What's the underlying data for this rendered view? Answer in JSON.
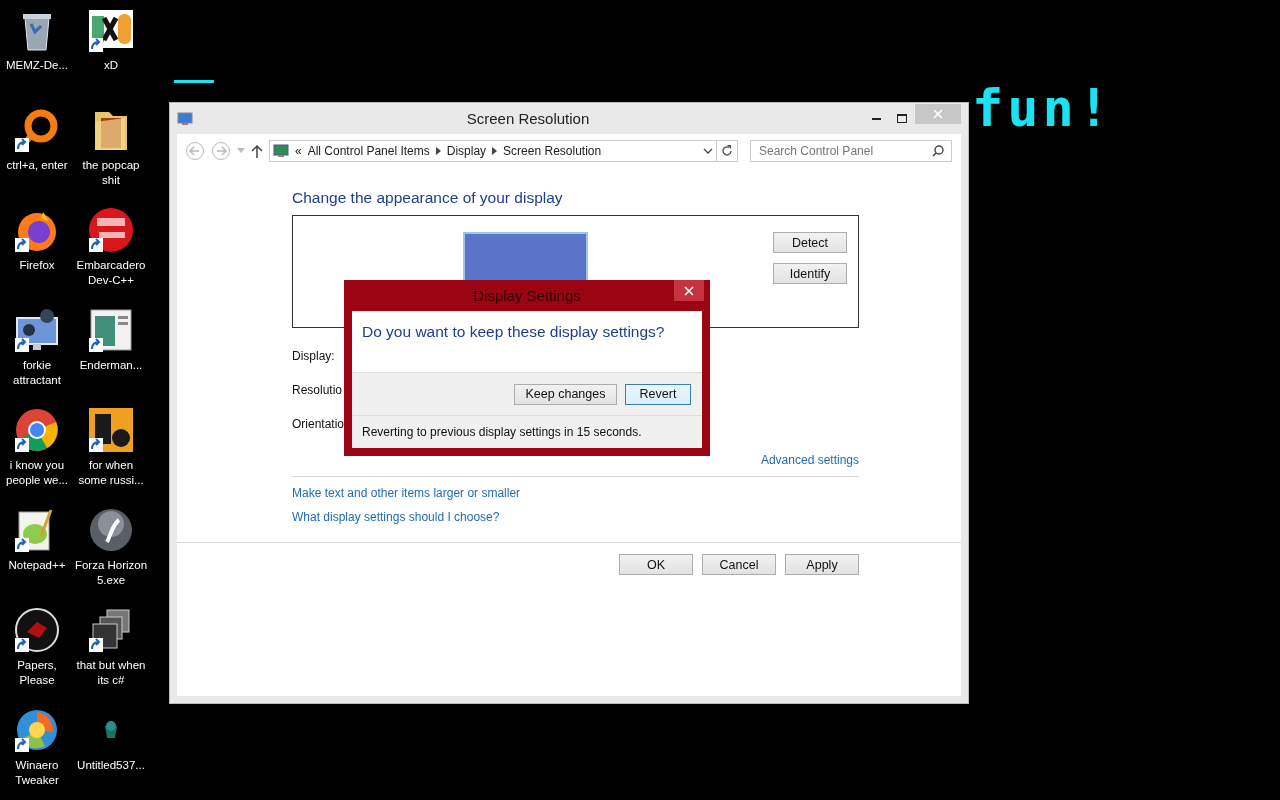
{
  "desktop": {
    "icons": [
      {
        "label": "MEMZ-De...",
        "kind": "bin",
        "shortcut": false
      },
      {
        "label": "xD",
        "kind": "blocks",
        "shortcut": true
      },
      {
        "label": "ctrl+a, enter",
        "kind": "ring",
        "shortcut": true
      },
      {
        "label": "the popcap shit",
        "kind": "folder",
        "shortcut": false
      },
      {
        "label": "Firefox",
        "kind": "fox",
        "shortcut": true
      },
      {
        "label": "Embarcadero Dev-C++",
        "kind": "redball",
        "shortcut": true
      },
      {
        "label": "forkie attractant",
        "kind": "gears",
        "shortcut": true
      },
      {
        "label": "Enderman...",
        "kind": "document",
        "shortcut": true
      },
      {
        "label": "i know you people we...",
        "kind": "chrome",
        "shortcut": true
      },
      {
        "label": "for when some russi...",
        "kind": "square",
        "shortcut": true
      },
      {
        "label": "Notepad++",
        "kind": "notepad",
        "shortcut": true
      },
      {
        "label": "Forza Horizon 5.exe",
        "kind": "sphere",
        "shortcut": false
      },
      {
        "label": "Papers, Please",
        "kind": "seal",
        "shortcut": true
      },
      {
        "label": "that but when its c#",
        "kind": "stack",
        "shortcut": true
      },
      {
        "label": "Winaero Tweaker",
        "kind": "swirl",
        "shortcut": true
      },
      {
        "label": "Untitled537...",
        "kind": "dark",
        "shortcut": false
      }
    ]
  },
  "banner": {
    "text": "fun!"
  },
  "window": {
    "title": "Screen Resolution",
    "address": {
      "overflow": "«",
      "crumbs": [
        "All Control Panel Items",
        "Display",
        "Screen Resolution"
      ]
    },
    "search": {
      "placeholder": "Search Control Panel"
    },
    "heading": "Change the appearance of your display",
    "monitor_buttons": [
      "Detect",
      "Identify"
    ],
    "fields": [
      {
        "label": "Display:"
      },
      {
        "label": "Resolutio"
      },
      {
        "label": "Orientatio"
      }
    ],
    "advanced_link": "Advanced settings",
    "links": [
      "Make text and other items larger or smaller",
      "What display settings should I choose?"
    ],
    "buttons": [
      "OK",
      "Cancel",
      "Apply"
    ]
  },
  "dialog": {
    "title": "Display Settings",
    "question": "Do you want to keep these display settings?",
    "buttons": [
      {
        "label": "Keep changes",
        "focused": false
      },
      {
        "label": "Revert",
        "focused": true
      }
    ],
    "countdown": "Reverting to previous display settings in 15 seconds."
  }
}
